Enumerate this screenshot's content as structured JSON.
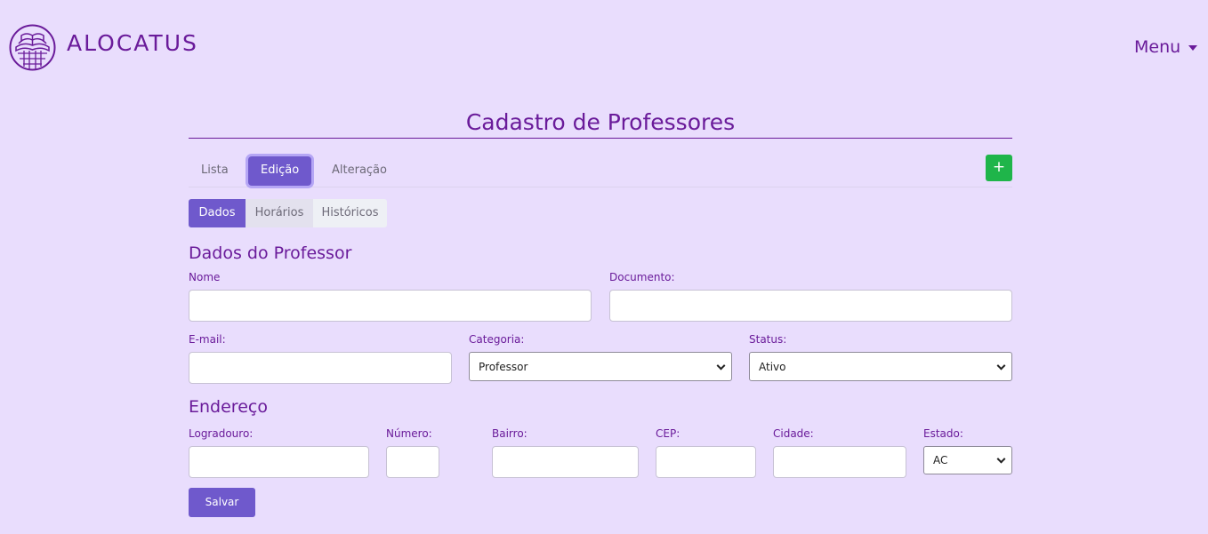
{
  "header": {
    "brand": "ALOCATUS",
    "menu_label": "Menu"
  },
  "page": {
    "title": "Cadastro de Professores"
  },
  "tabs": [
    {
      "label": "Lista"
    },
    {
      "label": "Edição",
      "active": true
    },
    {
      "label": "Alteração"
    }
  ],
  "add_button": {
    "label": "+"
  },
  "subtabs": [
    {
      "label": "Dados",
      "active": true
    },
    {
      "label": "Horários"
    },
    {
      "label": "Históricos"
    }
  ],
  "professor_section": {
    "title": "Dados do Professor",
    "nome_label": "Nome",
    "nome_value": "",
    "documento_label": "Documento:",
    "documento_value": "",
    "email_label": "E-mail:",
    "email_value": "",
    "categoria_label": "Categoria:",
    "categoria_value": "Professor",
    "status_label": "Status:",
    "status_value": "Ativo"
  },
  "endereco_section": {
    "title": "Endereço",
    "logradouro_label": "Logradouro:",
    "numero_label": "Número:",
    "bairro_label": "Bairro:",
    "cep_label": "CEP:",
    "cidade_label": "Cidade:",
    "estado_label": "Estado:",
    "estado_value": "AC"
  },
  "save_button": {
    "label": "Salvar"
  },
  "colors": {
    "background": "#e9ddfd",
    "primary": "#6f59cc",
    "text": "#6a1b9a",
    "success": "#1fb54a"
  }
}
